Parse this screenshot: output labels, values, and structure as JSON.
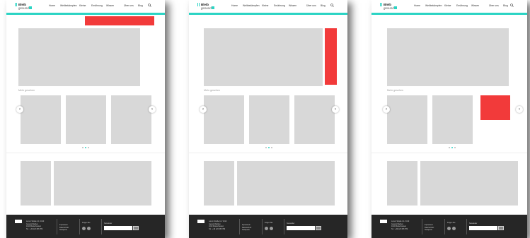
{
  "brand": {
    "line1": "Bleib",
    "line2": "gesund!"
  },
  "nav": {
    "items": [
      "Home",
      "Weltbekämpfen",
      "Kleine",
      "Ernährung",
      "Wissen",
      "Über uns",
      "Blog"
    ]
  },
  "section_label": "Mehr gesehen",
  "arrows": {
    "prev": "‹",
    "next": "›"
  },
  "footer": {
    "address": [
      "Lorem Straße 12 / 1010",
      "Gesund bleiben",
      "1010 Musterhausen",
      "Tel.: +49 123 456 789"
    ],
    "links": [
      "Impressum",
      "Datenschutz",
      "Netiquette"
    ],
    "follow_label": "Folgen Sie",
    "newsletter_label": "Newsletter",
    "newsletter_placeholder": "E-Mail",
    "submit_label": "OK"
  },
  "colors": {
    "accent": "#2bd4c4",
    "highlight": "#f23a3a",
    "placeholder": "#d8d8d8",
    "footer": "#262626"
  },
  "highlights": [
    "carousel-heading-area",
    "hero-side-panel",
    "carousel-card"
  ]
}
